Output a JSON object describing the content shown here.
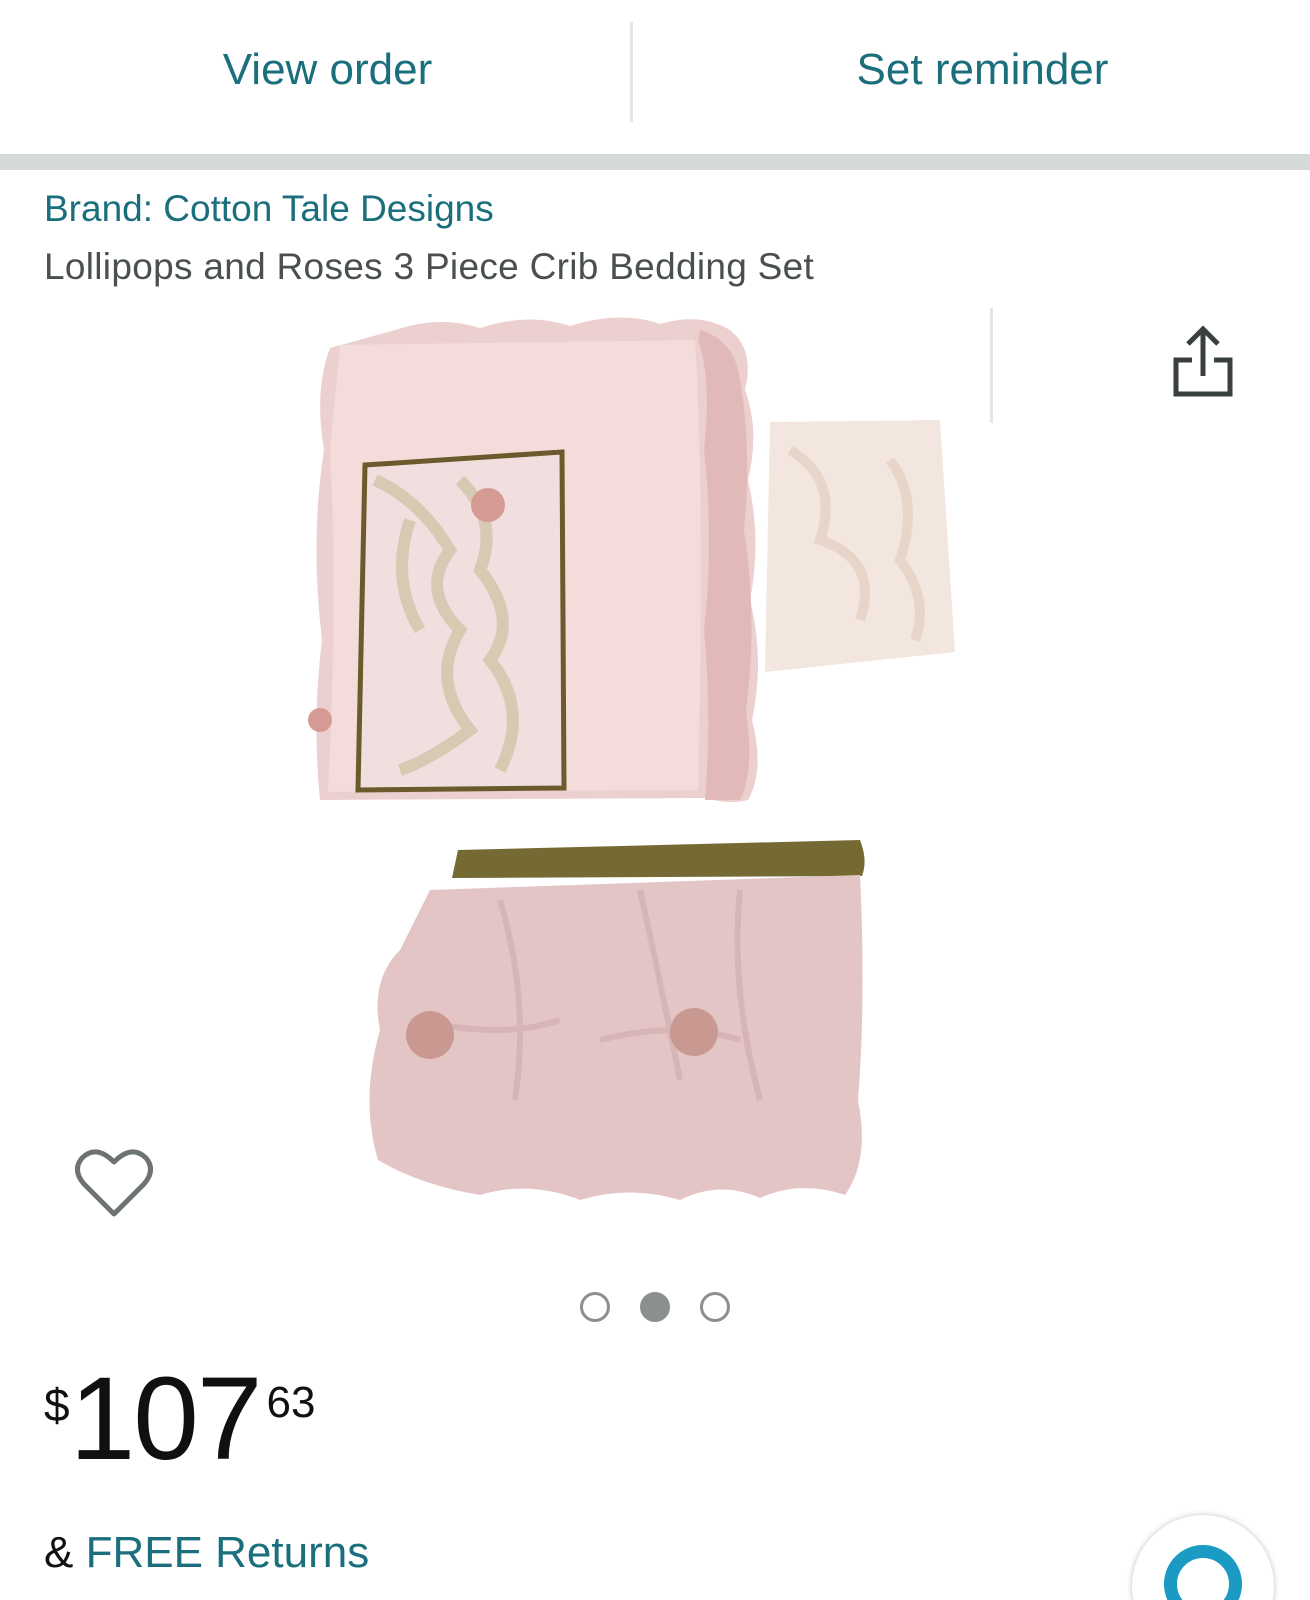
{
  "header": {
    "view_order": "View order",
    "set_reminder": "Set reminder"
  },
  "product": {
    "brand": "Brand: Cotton Tale Designs",
    "title": "Lollipops and Roses 3 Piece Crib Bedding Set"
  },
  "gallery": {
    "image_count": 3,
    "active_index": 1
  },
  "price": {
    "symbol": "$",
    "whole": "107",
    "fraction": "63"
  },
  "shipping": {
    "prefix": "& ",
    "returns_label": "FREE Returns"
  },
  "icons": {
    "share": "share-icon",
    "wishlist": "heart-icon",
    "assistant": "alexa-icon"
  },
  "colors": {
    "link": "#1b6f7d",
    "separator": "#d5d9d9",
    "assistant": "#1b9bc4",
    "fabric_pink": "#f0d2d2",
    "fabric_trim": "#756a34"
  }
}
